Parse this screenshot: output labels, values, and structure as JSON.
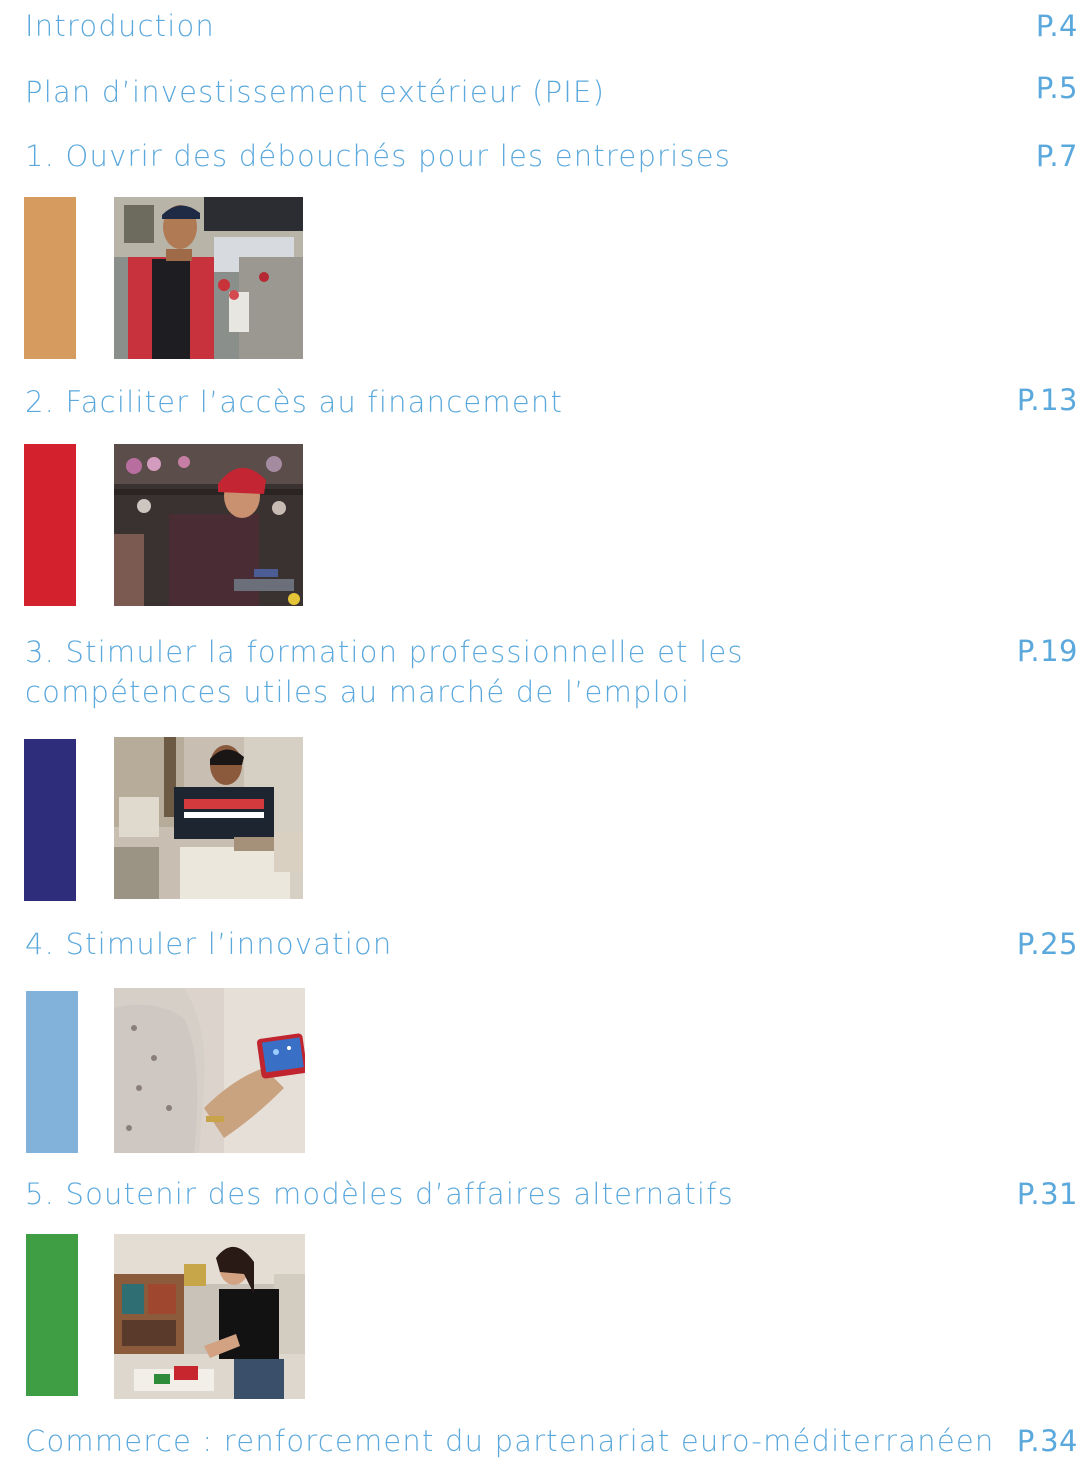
{
  "toc": {
    "intro": {
      "title": "Introduction",
      "page": "P.4"
    },
    "pie": {
      "title": "Plan d’investissement extérieur (PIE)",
      "page": "P.5"
    },
    "s1": {
      "title": "1. Ouvrir des débouchés pour les entreprises",
      "page": "P.7",
      "color": "#d69b5e",
      "photo": "man-selling-flowers-photo"
    },
    "s2": {
      "title": "2. Faciliter l’accès au financement",
      "page": "P.13",
      "color": "#d3222e",
      "photo": "woman-glass-crafting-photo"
    },
    "s3": {
      "title": "3. Stimuler la formation professionnelle et les compétences utiles au marché de l’emploi",
      "page": "P.19",
      "color": "#2e2d7b",
      "photo": "young-stonemason-photo"
    },
    "s4": {
      "title": "4. Stimuler l’innovation",
      "page": "P.25",
      "color": "#82b1d9",
      "photo": "woman-smartphone-photo"
    },
    "s5": {
      "title": "5. Soutenir des modèles d’affaires alternatifs",
      "page": "P.31",
      "color": "#3f9d44",
      "photo": "woman-craft-workshop-photo"
    },
    "commerce": {
      "title": "Commerce : renforcement du partenariat euro-méditerranéen",
      "page": "P.34"
    }
  }
}
